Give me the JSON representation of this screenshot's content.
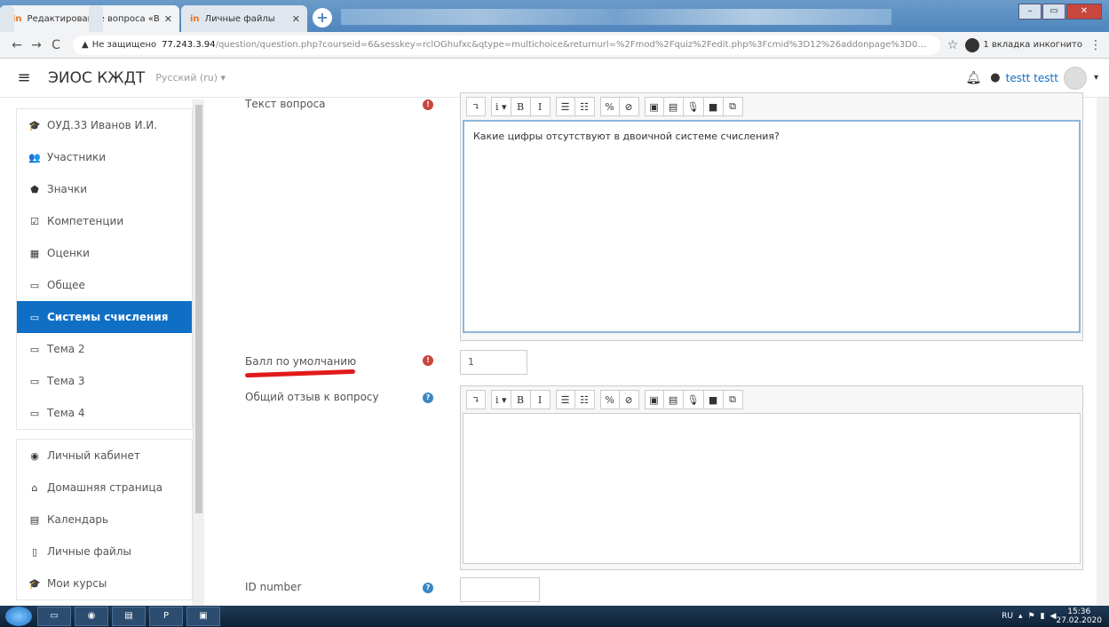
{
  "browser": {
    "tabs": [
      {
        "title": "Редактирование вопроса «В за",
        "active": true
      },
      {
        "title": "Личные файлы",
        "active": false
      }
    ],
    "address": {
      "warning": "▲",
      "security": "Не защищено",
      "host": "77.243.3.94",
      "path": "/question/question.php?courseid=6&sesskey=rclOGhufxc&qtype=multichoice&returnurl=%2Fmod%2Fquiz%2Fedit.php%3Fcmid%3D12%26addonpage%3D0&cmid=..."
    },
    "incognito_label": "1 вкладка инкогнито"
  },
  "header": {
    "site_name": "ЭИОС КЖДТ",
    "language": "Русский (ru) ▾",
    "user_name": "testt testt"
  },
  "sidebar": {
    "items": [
      {
        "label": "ОУД.33 Иванов И.И.",
        "icon": "graduation-cap-icon",
        "glyph": "🎓"
      },
      {
        "label": "Участники",
        "icon": "users-icon",
        "glyph": "👥"
      },
      {
        "label": "Значки",
        "icon": "shield-icon",
        "glyph": "⬟"
      },
      {
        "label": "Компетенции",
        "icon": "check-square-icon",
        "glyph": "☑"
      },
      {
        "label": "Оценки",
        "icon": "table-icon",
        "glyph": "▦"
      },
      {
        "label": "Общее",
        "icon": "folder-icon",
        "glyph": "▭"
      },
      {
        "label": "Системы счисления",
        "icon": "folder-icon",
        "glyph": "▭",
        "active": true
      },
      {
        "label": "Тема 2",
        "icon": "folder-icon",
        "glyph": "▭"
      },
      {
        "label": "Тема 3",
        "icon": "folder-icon",
        "glyph": "▭"
      },
      {
        "label": "Тема 4",
        "icon": "folder-icon",
        "glyph": "▭"
      }
    ],
    "items2": [
      {
        "label": "Личный кабинет",
        "icon": "dashboard-icon",
        "glyph": "◉"
      },
      {
        "label": "Домашняя страница",
        "icon": "home-icon",
        "glyph": "⌂"
      },
      {
        "label": "Календарь",
        "icon": "calendar-icon",
        "glyph": "▤"
      },
      {
        "label": "Личные файлы",
        "icon": "file-icon",
        "glyph": "▯"
      },
      {
        "label": "Мои курсы",
        "icon": "graduation-cap-icon",
        "glyph": "🎓"
      }
    ]
  },
  "form": {
    "question_text_label": "Текст вопроса",
    "question_text": "Какие цифры отсутствуют в двоичной системе счисления?",
    "default_mark_label": "Балл по умолчанию",
    "default_mark_value": "1",
    "general_feedback_label": "Общий отзыв к вопросу",
    "general_feedback": "",
    "id_number_label": "ID number"
  },
  "taskbar": {
    "lang": "RU",
    "time": "15:36",
    "date": "27.02.2020"
  },
  "colors": {
    "accent": "#0f6fc5",
    "required": "#c9463d",
    "help": "#3a87c4",
    "annotation": "#e01a1a"
  }
}
